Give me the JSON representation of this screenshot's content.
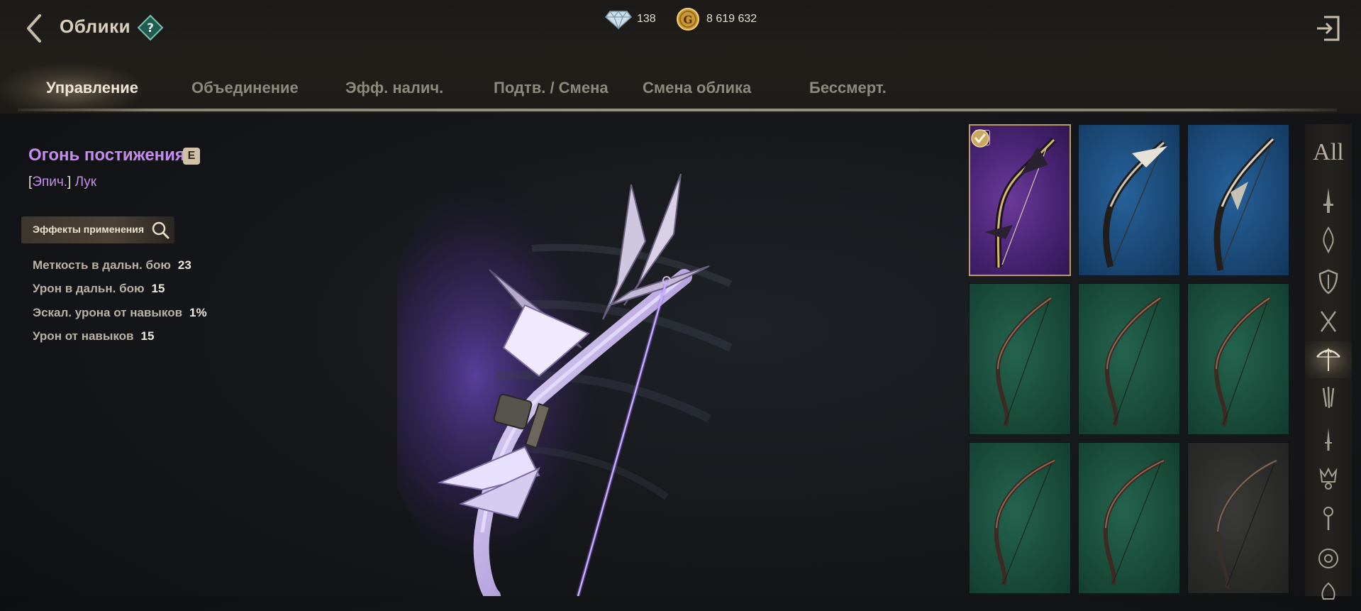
{
  "header": {
    "title": "Облики",
    "help_icon": "question-diamond-icon",
    "diamonds": "138",
    "gold": "8 619 632",
    "gold_icon_letter": "G"
  },
  "tabs": [
    {
      "label": "Управление",
      "active": true
    },
    {
      "label": "Объединение",
      "active": false
    },
    {
      "label": "Эфф. налич.",
      "active": false
    },
    {
      "label": "Подтв. / Смена",
      "active": false
    },
    {
      "label": "Смена облика",
      "active": false
    },
    {
      "label": "Бессмерт.",
      "active": false
    }
  ],
  "item": {
    "name": "Огонь постижения",
    "equipped_badge": "E",
    "bracket_open": "[",
    "rarity": "Эпич.",
    "bracket_close": "]",
    "type": "Лук",
    "name_color": "#c68cf0"
  },
  "effects_button": {
    "label": "Эффекты применения",
    "icon": "search-icon"
  },
  "stats": [
    {
      "name": "Меткость в дальн. бою",
      "value": "23"
    },
    {
      "name": "Урон в дальн. бою",
      "value": "15"
    },
    {
      "name": "Эскал. урона от навыков",
      "value": "1%"
    },
    {
      "name": "Урон от навыков",
      "value": "15"
    }
  ],
  "grid": [
    {
      "rarity": "epic",
      "equipped": true,
      "badge": "E",
      "selected": true
    },
    {
      "rarity": "rare",
      "equipped": false
    },
    {
      "rarity": "rare",
      "equipped": false
    },
    {
      "rarity": "uncommon",
      "equipped": false
    },
    {
      "rarity": "uncommon",
      "equipped": false
    },
    {
      "rarity": "uncommon",
      "equipped": false
    },
    {
      "rarity": "uncommon",
      "equipped": false
    },
    {
      "rarity": "uncommon",
      "equipped": false
    },
    {
      "rarity": "common",
      "equipped": false
    }
  ],
  "categories": {
    "all_label": "All",
    "icons": [
      "sword-icon",
      "flame-dagger-icon",
      "shield-icon",
      "crossed-blades-icon",
      "bow-icon",
      "claws-icon",
      "dagger-icon",
      "crown-orb-icon",
      "staff-icon",
      "eye-orb-icon",
      "flame-mask-icon"
    ],
    "active_index": 4
  },
  "colors": {
    "epic": "#4a2474",
    "rare": "#1b4a78",
    "uncommon": "#1a4d3b",
    "common": "#2b2b2a",
    "accent_gold": "#b79c67"
  }
}
